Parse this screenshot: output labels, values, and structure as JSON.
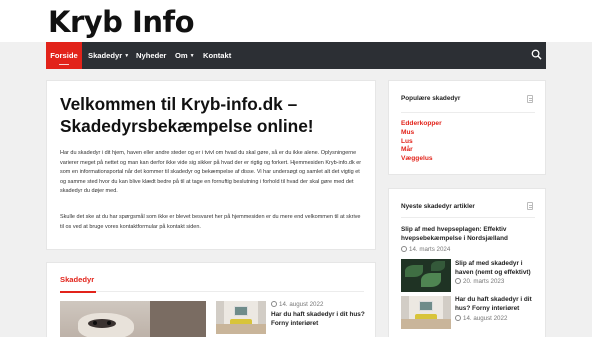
{
  "site": {
    "logo": "Kryb Info"
  },
  "nav": {
    "items": [
      {
        "label": "Forside",
        "active": true
      },
      {
        "label": "Skadedyr",
        "has_dropdown": true
      },
      {
        "label": "Nyheder"
      },
      {
        "label": "Om",
        "has_dropdown": true
      },
      {
        "label": "Kontakt"
      }
    ],
    "search_icon": "search-icon"
  },
  "main": {
    "heading": "Velkommen til Kryb-info.dk – Skadedyrsbekæmpelse online!",
    "paragraph1": "Har du skadedyr i dit hjem, haven eller andre steder og er i tvivl om hvad du skal gøre, så er du ikke alene. Oplysningerne varierer meget på nettet og man kan derfor ikke vide sig sikker på hvad der er rigtig og forkert. Hjemmesiden Kryb-info.dk er som en informationsportal når det kommer til skadedyr og bekæmpelse af disse. Vi har undersøgt og samlet alt det vigtig et og samme sted hvor du kan blive klædt bedre på til at tage en fornuftig beslutning i forhold til hvad der skal gøre med det skadedyr du døjer med.",
    "paragraph2": "Skulle det ske at du har spørgsmål som ikke er blevet besvaret her på hjemmesiden er du mere end velkommen til at skrive til os ved at bruge vores kontaktformular på kontakt siden."
  },
  "skadedyr_section": {
    "title": "Skadedyr",
    "post": {
      "date": "14. august 2022",
      "title": "Har du haft skadedyr i dit hus? Forny interiøret"
    }
  },
  "sidebar": {
    "popular": {
      "title": "Populære skadedyr",
      "items": [
        "Edderkopper",
        "Mus",
        "Lus",
        "Mår",
        "Væggelus"
      ]
    },
    "latest": {
      "title": "Nyeste skadedyr artikler",
      "articles": [
        {
          "title": "Slip af med hvepseplagen: Effektiv hvepsebekæmpelse i Nordsjælland",
          "date": "14. marts 2024"
        },
        {
          "title": "Slip af med skadedyr i haven (nemt og effektivt)",
          "date": "20. marts 2023"
        },
        {
          "title": "Har du haft skadedyr i dit hus? Forny interiøret",
          "date": "14. august 2022"
        }
      ]
    }
  },
  "colors": {
    "accent": "#e2231a",
    "nav_bg": "#2c2f34",
    "page_bg": "#f0f0f0"
  }
}
